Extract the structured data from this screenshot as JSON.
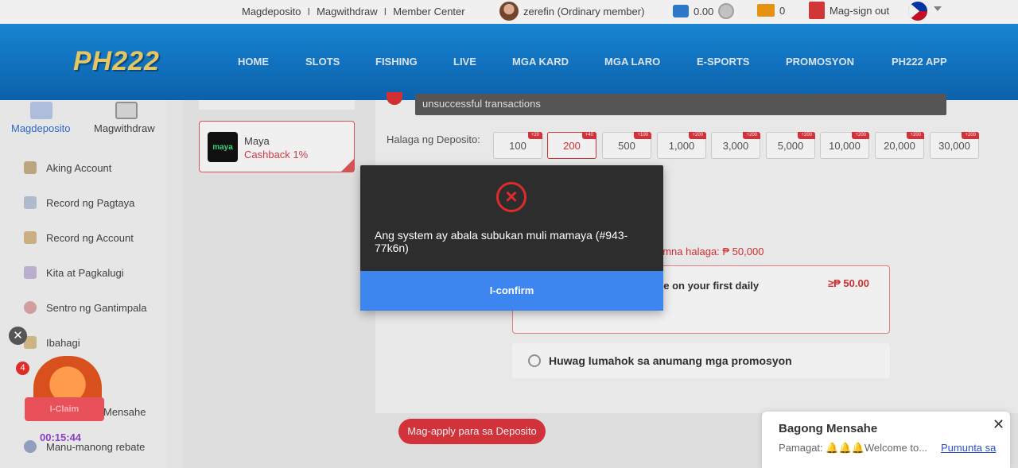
{
  "topbar": {
    "deposit_link": "Magdeposito",
    "withdraw_link": "Magwithdraw",
    "member_center_link": "Member Center",
    "separator": "I",
    "username": "zerefin (Ordinary member)",
    "balance": "0.00",
    "mail_count": "0",
    "signout_label": "Mag-sign out"
  },
  "logo_text": "PH222",
  "nav": [
    "HOME",
    "SLOTS",
    "FISHING",
    "LIVE",
    "MGA KARD",
    "MGA LARO",
    "E-SPORTS",
    "PROMOSYON",
    "PH222 APP"
  ],
  "sidebar": {
    "tab_deposit": "Magdeposito",
    "tab_withdraw": "Magwithdraw",
    "items": [
      "Aking Account",
      "Record ng Pagtaya",
      "Record ng Account",
      "Kita at Pagkalugi",
      "Sentro ng Gantimpala",
      "Ibahagi",
      "Mensahe",
      "Manu-manong rebate"
    ]
  },
  "payment_method": {
    "logo_text": "maya",
    "name": "Maya",
    "cashback": "Cashback 1%"
  },
  "notice_text": "unsuccessful transactions",
  "deposit": {
    "amount_label": "Halaga ng Deposito:",
    "amounts": [
      {
        "value": "100",
        "badge": "+20"
      },
      {
        "value": "200",
        "badge": "+40"
      },
      {
        "value": "500",
        "badge": "+100"
      },
      {
        "value": "1,000",
        "badge": "+200"
      },
      {
        "value": "3,000",
        "badge": "+200"
      },
      {
        "value": "5,000",
        "badge": "+200"
      },
      {
        "value": "10,000",
        "badge": "+200"
      },
      {
        "value": "20,000",
        "badge": "+200"
      },
      {
        "value": "30,000",
        "badge": "+200"
      }
    ],
    "selected_amount": "200",
    "max_text": "umna halaga: ₱ 50,000",
    "promo_text": "ee on your first daily",
    "promo_amount": "≥₱ 50.00",
    "no_promo_text": "Huwag lumahok sa anumang mga promosyon",
    "apply_button": "Mag-apply para sa Deposito"
  },
  "modal": {
    "message": "Ang system ay abala subukan muli mamaya (#943-77k6n)",
    "confirm_button": "I-confirm",
    "icon": "error-x-icon"
  },
  "gift": {
    "close": "✕",
    "badge": "4",
    "button": "I-Claim",
    "timer": "00:15:44"
  },
  "toast": {
    "title": "Bagong Mensahe",
    "close": "✕",
    "body": "Pamagat: 🔔🔔🔔Welcome to...",
    "link": "Pumunta sa"
  },
  "colors": {
    "nav_blue": "#1278cf",
    "accent_red": "#e0373f",
    "confirm_blue": "#3d86f0",
    "modal_bg": "#2d2d2d"
  }
}
